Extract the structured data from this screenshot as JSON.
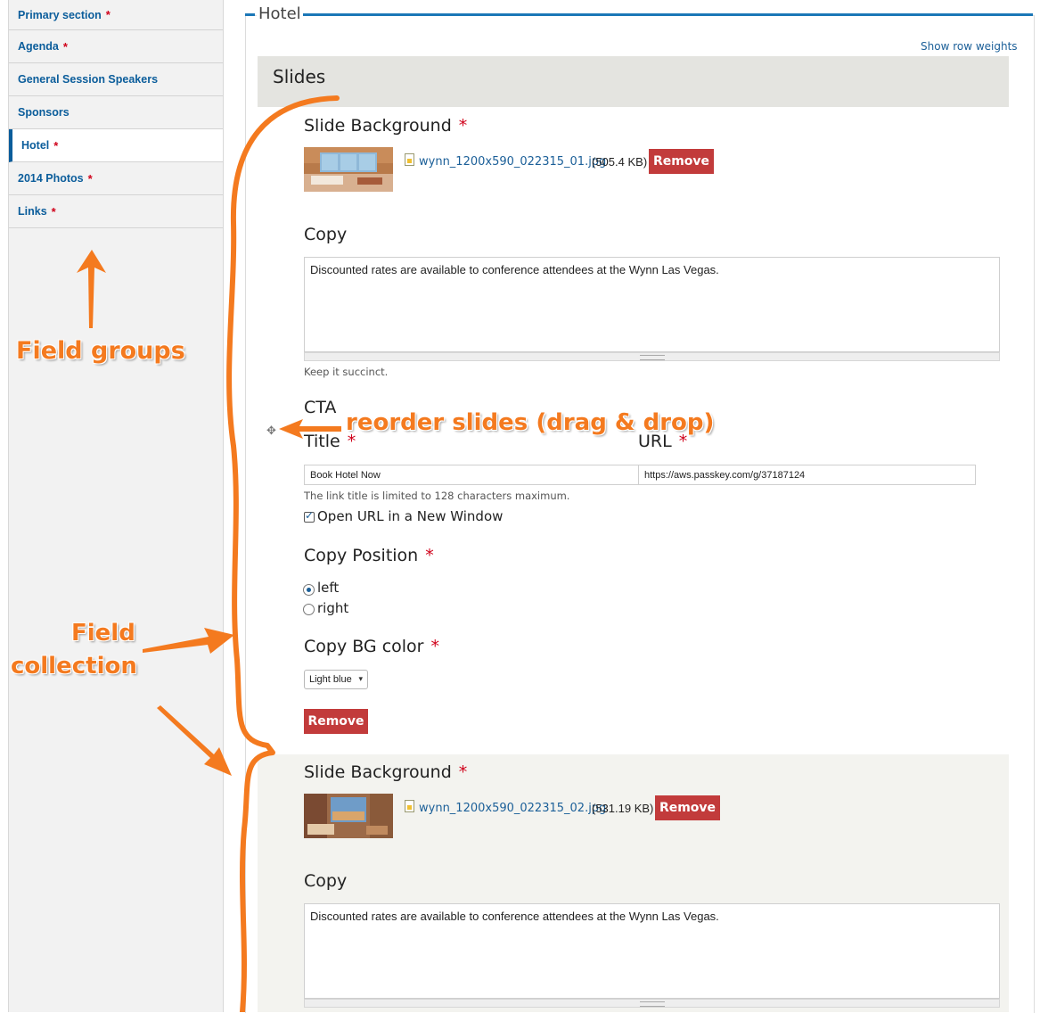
{
  "sidebar": {
    "tabs": [
      {
        "label": "Primary section",
        "required": "*"
      },
      {
        "label": "Agenda",
        "required": "*"
      },
      {
        "label": "General Session Speakers",
        "required": ""
      },
      {
        "label": "Sponsors",
        "required": ""
      },
      {
        "label": "Hotel",
        "required": "*",
        "active": true
      },
      {
        "label": "2014 Photos",
        "required": "*"
      },
      {
        "label": "Links",
        "required": "*"
      }
    ]
  },
  "fieldset": {
    "legend": "Hotel",
    "show_row_weights": "Show row weights",
    "slides_title": "Slides"
  },
  "colors": {
    "accent": "#1b77b7",
    "link": "#1b5f98",
    "remove_button": "#c23b3b",
    "required": "#d0021b",
    "annotation": "#f47a1f"
  },
  "slides": [
    {
      "background_label": "Slide Background",
      "required": "*",
      "file_name": "wynn_1200x590_022315_01.jpg",
      "file_size": "(505.4 KB)",
      "remove_label": "Remove",
      "copy_label": "Copy",
      "copy_text": "Discounted rates are available to conference attendees at the Wynn Las Vegas.",
      "copy_help": "Keep it succinct.",
      "cta_label": "CTA",
      "title_label": "Title",
      "url_label": "URL",
      "title_value": "Book Hotel Now",
      "url_value": "https://aws.passkey.com/g/37187124",
      "title_help": "The link title is limited to 128 characters maximum.",
      "new_window_label": "Open URL in a New Window",
      "position_label": "Copy Position",
      "position_options": [
        "left",
        "right"
      ],
      "position_selected": "left",
      "bg_color_label": "Copy BG color",
      "bg_color_value": "Light blue",
      "remove_item_label": "Remove"
    },
    {
      "background_label": "Slide Background",
      "required": "*",
      "file_name": "wynn_1200x590_022315_02.jpg",
      "file_size": "(531.19 KB)",
      "remove_label": "Remove",
      "copy_label": "Copy",
      "copy_text": "Discounted rates are available to conference attendees at the Wynn Las Vegas."
    }
  ],
  "annotations": {
    "field_groups": "Field groups",
    "reorder": "reorder slides (drag & drop)",
    "field_collection_line1": "Field",
    "field_collection_line2": "collection"
  },
  "icons": {
    "drag_handle": "move-icon",
    "file": "image-file-icon",
    "dropdown": "chevron-down-icon"
  }
}
